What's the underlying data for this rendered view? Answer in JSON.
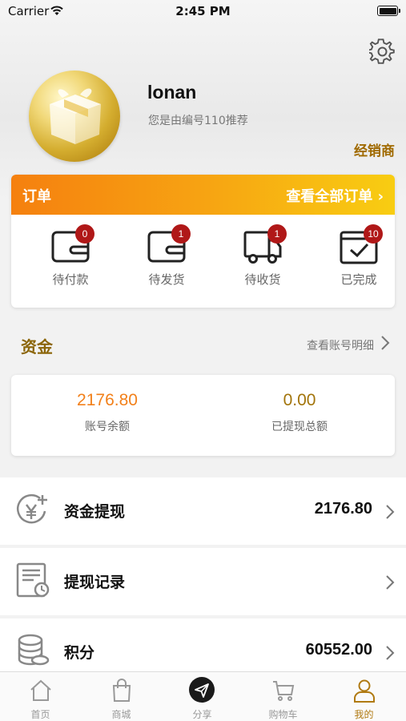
{
  "status_bar": {
    "carrier": "Carrier",
    "time": "2:45 PM"
  },
  "profile": {
    "name": "lonan",
    "referral": "您是由编号110推荐",
    "role": "经销商"
  },
  "orders": {
    "title": "订单",
    "view_all": "查看全部订单 ›",
    "items": [
      {
        "label": "待付款",
        "badge": "0",
        "icon": "wallet-icon"
      },
      {
        "label": "待发货",
        "badge": "1",
        "icon": "wallet-icon"
      },
      {
        "label": "待收货",
        "badge": "1",
        "icon": "truck-icon"
      },
      {
        "label": "已完成",
        "badge": "10",
        "icon": "calendar-check-icon"
      }
    ]
  },
  "funds": {
    "title": "资金",
    "detail_link": "查看账号明细",
    "balance_value": "2176.80",
    "balance_label": "账号余额",
    "withdrawn_value": "0.00",
    "withdrawn_label": "已提现总额"
  },
  "list": [
    {
      "label": "资金提现",
      "value": "2176.80",
      "icon": "yen-withdraw-icon"
    },
    {
      "label": "提现记录",
      "value": "",
      "icon": "record-icon"
    },
    {
      "label": "积分",
      "value": "60552.00",
      "icon": "coins-icon"
    }
  ],
  "tabs": [
    {
      "label": "首页",
      "icon": "home-icon"
    },
    {
      "label": "商城",
      "icon": "shopping-bag-icon"
    },
    {
      "label": "分享",
      "icon": "share-icon"
    },
    {
      "label": "购物车",
      "icon": "cart-icon"
    },
    {
      "label": "我的",
      "icon": "user-icon",
      "active": true
    }
  ],
  "colors": {
    "accent_gold": "#a2740a",
    "accent_orange": "#f2801a",
    "badge_red": "#b01818",
    "header_gradient_start": "#f5800f",
    "header_gradient_end": "#f8cd12"
  }
}
